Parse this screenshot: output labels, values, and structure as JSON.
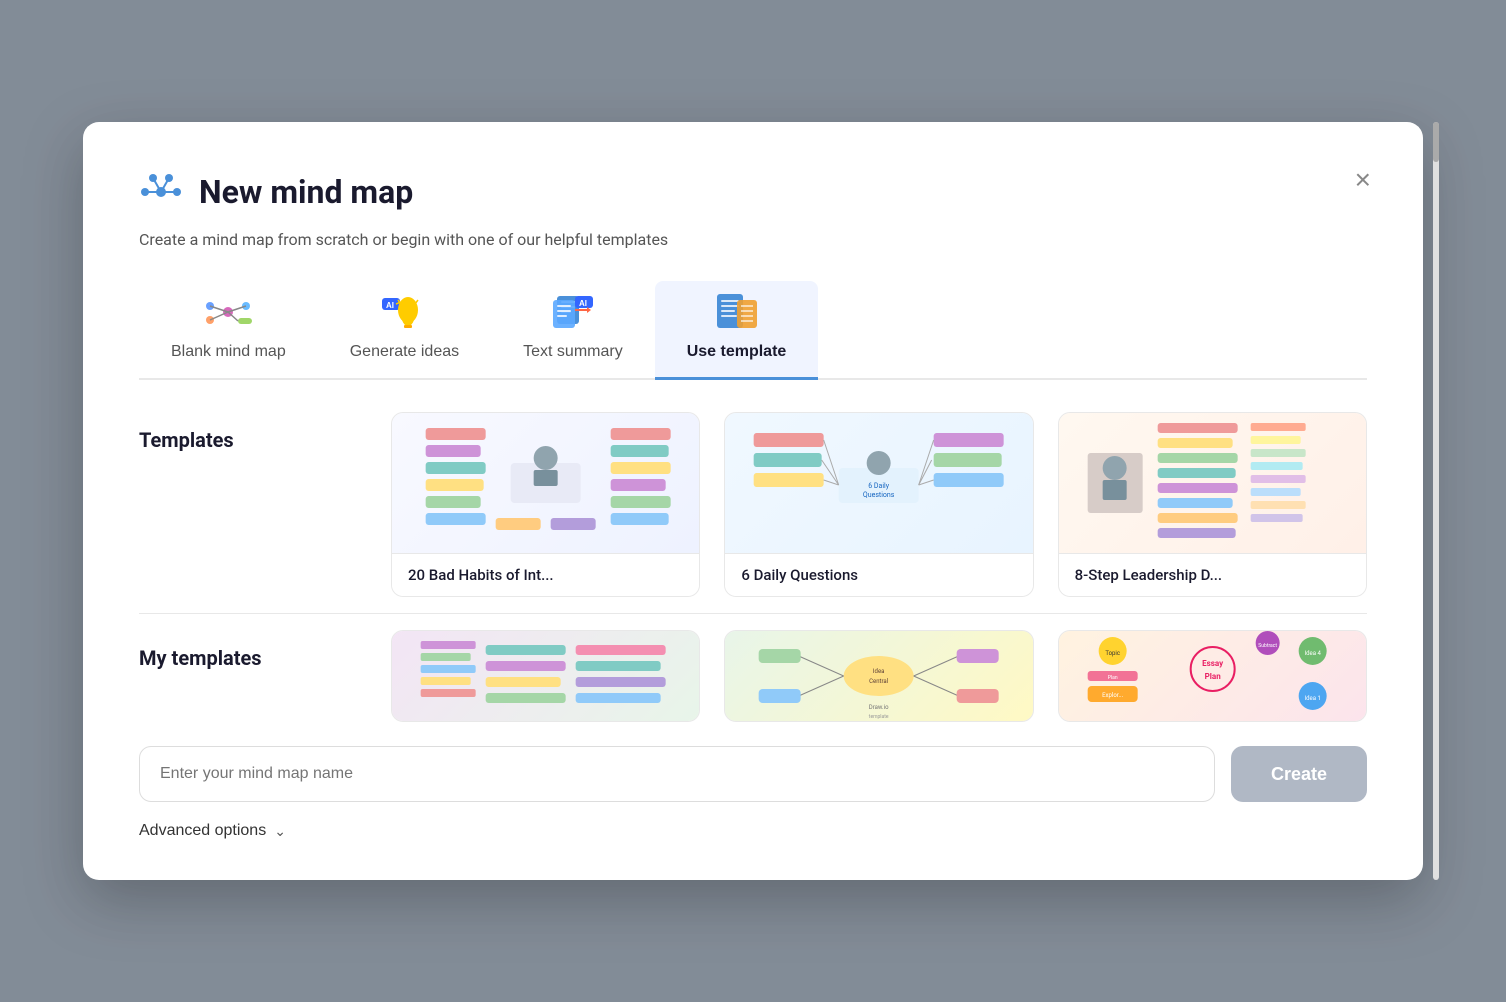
{
  "modal": {
    "title": "New mind map",
    "subtitle": "Create a mind map from scratch or begin with one of our helpful templates",
    "close_label": "×"
  },
  "tabs": [
    {
      "id": "blank",
      "label": "Blank mind map",
      "active": false
    },
    {
      "id": "generate",
      "label": "Generate ideas",
      "active": false
    },
    {
      "id": "text",
      "label": "Text summary",
      "active": false
    },
    {
      "id": "template",
      "label": "Use template",
      "active": true
    }
  ],
  "sections": {
    "templates": {
      "label": "Templates",
      "items": [
        {
          "name": "20 Bad Habits of Int...",
          "id": "bad-habits"
        },
        {
          "name": "6 Daily Questions",
          "id": "daily-questions"
        },
        {
          "name": "8-Step Leadership D...",
          "id": "leadership"
        }
      ]
    },
    "my_templates": {
      "label": "My templates",
      "items": [
        {
          "name": "",
          "id": "my-1"
        },
        {
          "name": "",
          "id": "my-2"
        },
        {
          "name": "",
          "id": "my-3"
        }
      ]
    }
  },
  "input": {
    "placeholder": "Enter your mind map name",
    "value": ""
  },
  "buttons": {
    "create": "Create",
    "advanced_options": "Advanced options"
  },
  "icons": {
    "logo": "mindmap-logo",
    "close": "close-icon",
    "blank_tab": "blank-mindmap-icon",
    "generate_tab": "ai-lightbulb-icon",
    "text_tab": "ai-text-icon",
    "template_tab": "template-icon",
    "chevron_down": "chevron-down-icon"
  },
  "colors": {
    "accent": "#4a90d9",
    "disabled_btn": "#b0b8c5",
    "title": "#1a1a2e"
  }
}
